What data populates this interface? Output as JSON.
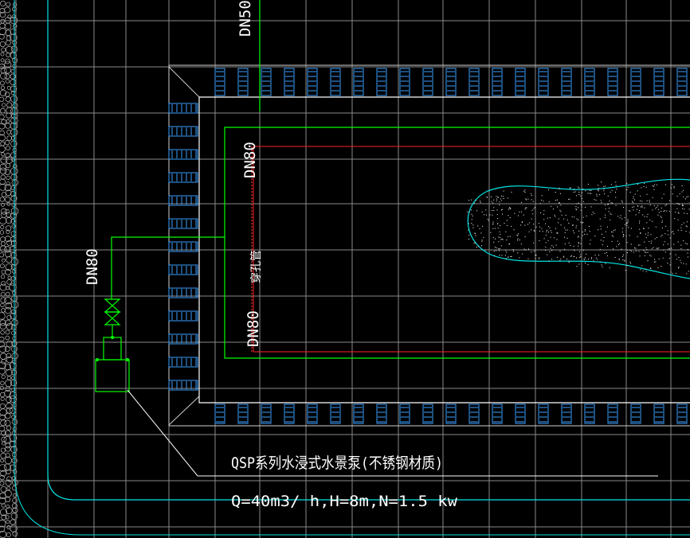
{
  "drawing": {
    "labels": {
      "pipe_top": "DN50",
      "pipe_inner_top": "DN80",
      "pipe_inner_bottom": "DN80",
      "pipe_pump": "DN80",
      "sleeve": "穿孔管",
      "pump_name": "QSP系列水浸式水景泵(不锈钢材质)",
      "pump_spec": "Q=40m3/ h,H=8m,N=1.5 kw"
    },
    "colors": {
      "background": "#000000",
      "grid": "#8a8a8a",
      "boundary": "#00e5e5",
      "pipe": "#00ff00",
      "drain": "#ff2020",
      "grate": "#3aa0ff",
      "text": "#ffffff",
      "gravel": "#bfbfbf"
    }
  }
}
